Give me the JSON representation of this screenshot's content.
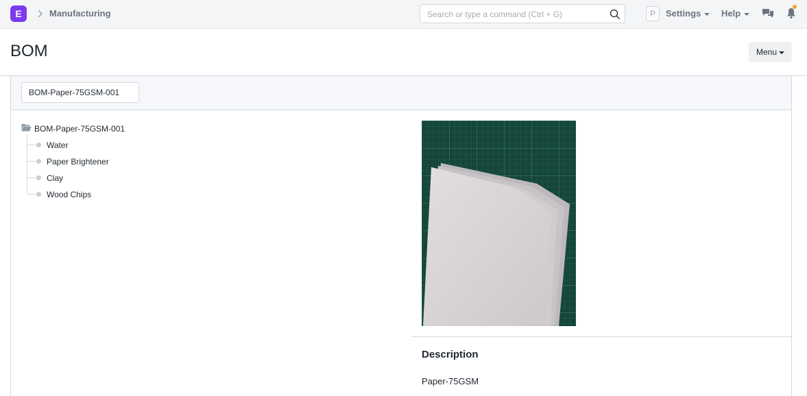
{
  "navbar": {
    "logo_letter": "E",
    "breadcrumb": "Manufacturing",
    "search_placeholder": "Search or type a command (Ctrl + G)",
    "avatar_letter": "P",
    "settings_label": "Settings",
    "help_label": "Help",
    "icons": [
      "chevron-right-icon",
      "search-icon",
      "chat-icon",
      "bell-icon"
    ],
    "notification_dot_color": "#f5a623"
  },
  "page": {
    "title": "BOM",
    "menu_label": "Menu"
  },
  "filter": {
    "bom_value": "BOM-Paper-75GSM-001"
  },
  "tree": {
    "root": "BOM-Paper-75GSM-001",
    "children": [
      "Water",
      "Paper Brightener",
      "Clay",
      "Wood Chips"
    ]
  },
  "detail": {
    "description_heading": "Description",
    "description_value": "Paper-75GSM"
  },
  "colors": {
    "brand": "#7c3aed"
  }
}
